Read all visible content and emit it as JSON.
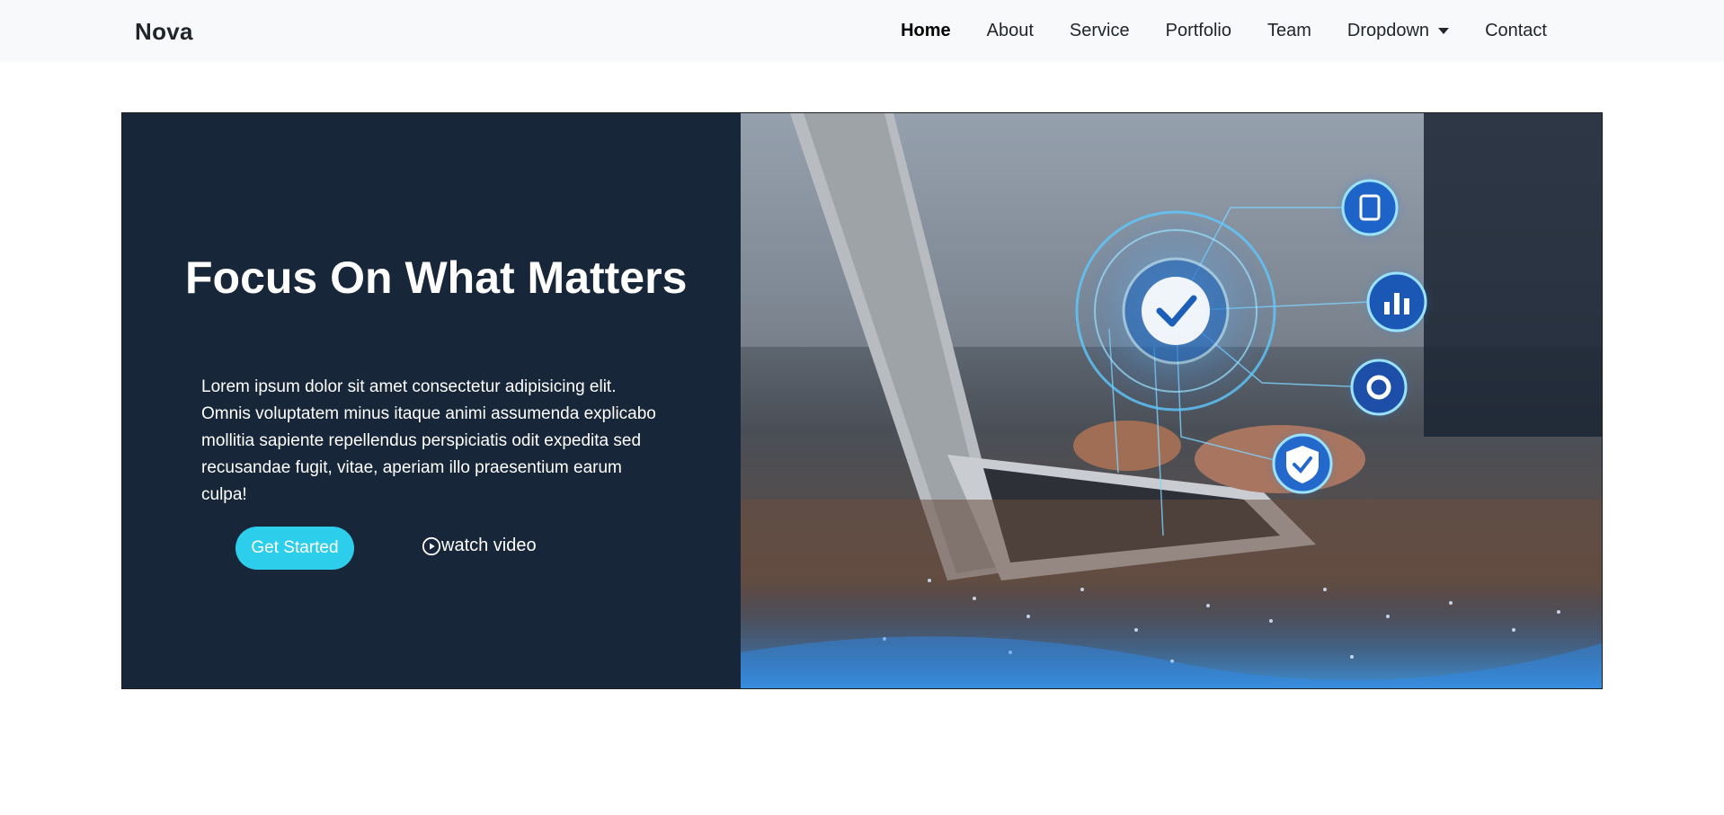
{
  "navbar": {
    "brand": "Nova",
    "links": [
      {
        "label": "Home",
        "active": true
      },
      {
        "label": "About"
      },
      {
        "label": "Service"
      },
      {
        "label": "Portfolio"
      },
      {
        "label": "Team"
      },
      {
        "label": "Dropdown",
        "has_caret": true
      },
      {
        "label": "Contact"
      }
    ]
  },
  "hero": {
    "title": "Focus On What Matters",
    "text": "Lorem ipsum dolor sit amet consectetur adipisicing elit. Omnis voluptatem minus itaque animi assumenda explicabo mollitia sapiente repellendus perspiciatis odit expedita sed recusandae fugit, vitae, aperiam illo praesentium earum culpa!",
    "cta_label": "Get Started",
    "video_label": "watch video",
    "accent_color": "#2dcdec",
    "panel_color": "#172639",
    "image_icons": [
      "gear-check-icon",
      "clipboard-icon",
      "chart-icon",
      "settings-icon",
      "shield-check-icon"
    ]
  }
}
